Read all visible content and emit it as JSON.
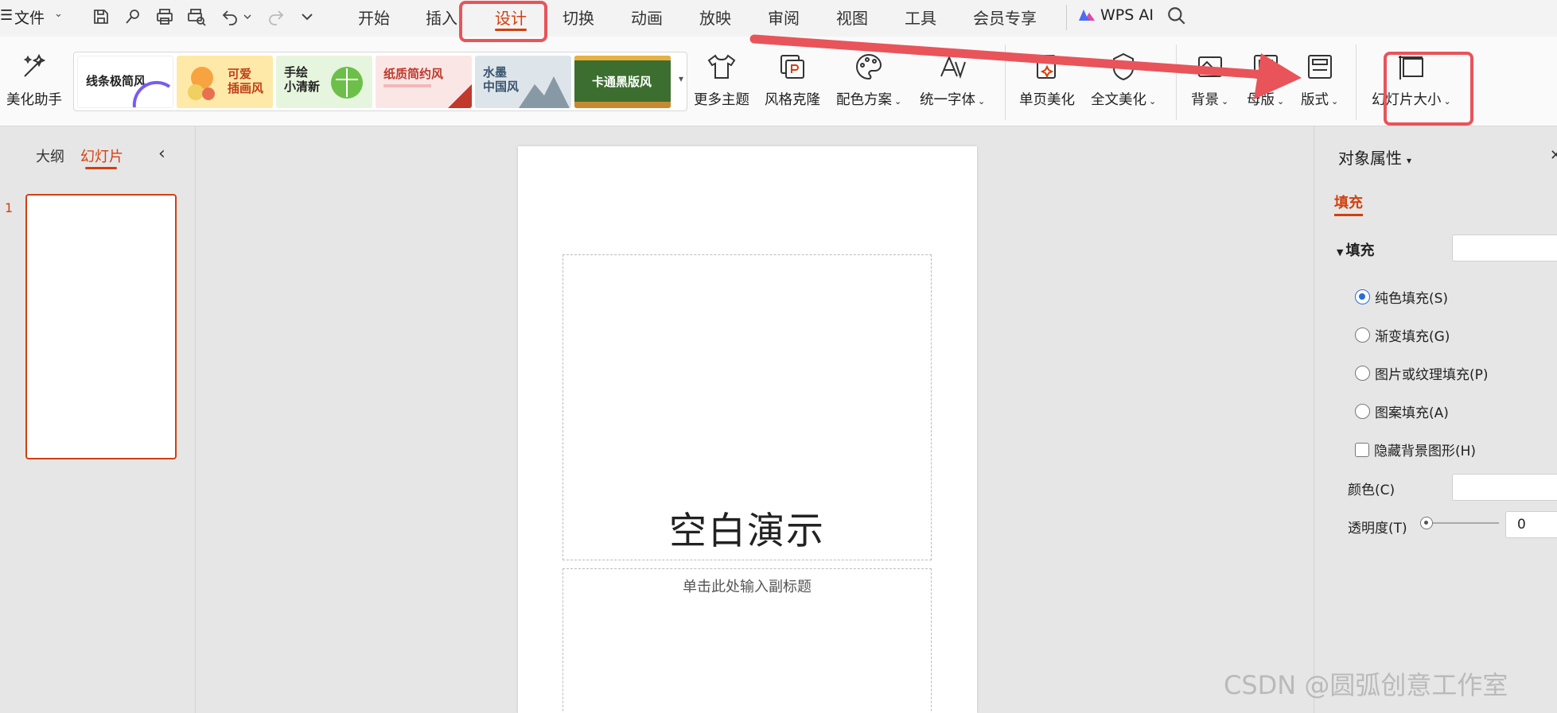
{
  "menubar": {
    "file_label": "文件",
    "tabs": [
      "开始",
      "插入",
      "设计",
      "切换",
      "动画",
      "放映",
      "审阅",
      "视图",
      "工具",
      "会员专享"
    ],
    "active_tab": "设计",
    "wps_ai": "WPS AI"
  },
  "ribbon": {
    "beautify": "美化助手",
    "themes": [
      {
        "label": "线条极简风"
      },
      {
        "label": "可爱\n插画风"
      },
      {
        "label": "手绘\n小清新"
      },
      {
        "label": "纸质简约风"
      },
      {
        "label": "水墨\n中国风"
      },
      {
        "label": "卡通黑版风"
      }
    ],
    "more_themes": "更多主题",
    "style_clone": "风格克隆",
    "color_scheme": "配色方案",
    "unify_font": "统一字体",
    "page_beautify": "单页美化",
    "full_beautify": "全文美化",
    "background": "背景",
    "master": "母版",
    "layout": "版式",
    "slide_size": "幻灯片大小"
  },
  "left_pane": {
    "tab_outline": "大纲",
    "tab_slides": "幻灯片",
    "slide_number": "1"
  },
  "slide": {
    "title": "空白演示",
    "subtitle_placeholder": "单击此处输入副标题"
  },
  "right_pane": {
    "title": "对象属性",
    "tab": "填充",
    "section": "填充",
    "options": [
      {
        "label": "纯色填充(S)",
        "checked": true
      },
      {
        "label": "渐变填充(G)",
        "checked": false
      },
      {
        "label": "图片或纹理填充(P)",
        "checked": false
      },
      {
        "label": "图案填充(A)",
        "checked": false
      }
    ],
    "hide_bg": "隐藏背景图形(H)",
    "color_label": "颜色(C)",
    "opacity_label": "透明度(T)",
    "opacity_value": "0"
  },
  "watermark": "CSDN @圆弧创意工作室",
  "colors": {
    "accent": "#d2400f",
    "annotation": "#e8545a",
    "radio_on": "#2a6dd6"
  }
}
